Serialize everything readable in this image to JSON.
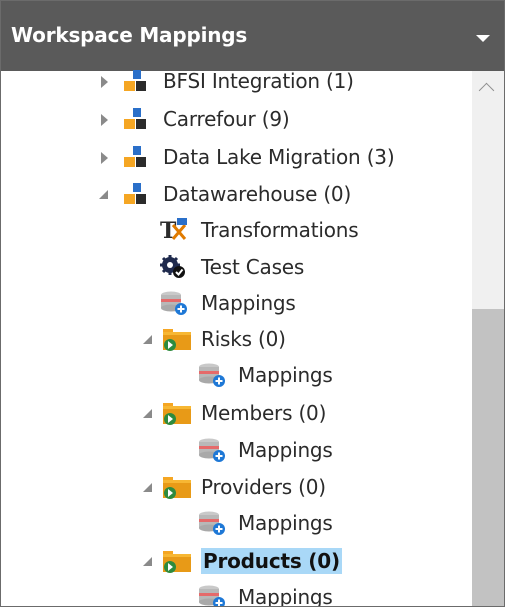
{
  "header": {
    "title": "Workspace Mappings"
  },
  "tree": {
    "items": [
      {
        "label": "BFSI Integration (1)",
        "type": "workspace",
        "expanded": false,
        "level": 0
      },
      {
        "label": "Carrefour (9)",
        "type": "workspace",
        "expanded": false,
        "level": 0
      },
      {
        "label": "Data Lake Migration (3)",
        "type": "workspace",
        "expanded": false,
        "level": 0
      },
      {
        "label": "Datawarehouse (0)",
        "type": "workspace",
        "expanded": true,
        "level": 0
      },
      {
        "label": "Transformations",
        "type": "transformations",
        "level": 1
      },
      {
        "label": "Test Cases",
        "type": "test-cases",
        "level": 1
      },
      {
        "label": "Mappings",
        "type": "mappings",
        "level": 1
      },
      {
        "label": "Risks (0)",
        "type": "subject-area",
        "expanded": true,
        "level": 1
      },
      {
        "label": "Mappings",
        "type": "mappings",
        "level": 2
      },
      {
        "label": "Members (0)",
        "type": "subject-area",
        "expanded": true,
        "level": 1
      },
      {
        "label": "Mappings",
        "type": "mappings",
        "level": 2
      },
      {
        "label": "Providers (0)",
        "type": "subject-area",
        "expanded": true,
        "level": 1
      },
      {
        "label": "Mappings",
        "type": "mappings",
        "level": 2
      },
      {
        "label": "Products (0)",
        "type": "subject-area",
        "expanded": true,
        "selected": true,
        "level": 1
      },
      {
        "label": "Mappings",
        "type": "mappings",
        "level": 2
      }
    ]
  },
  "colors": {
    "header_bg": "#5a5a5a",
    "selection": "#a9d8f7",
    "workspace_orange": "#f5a623",
    "workspace_blue": "#2a6fc9",
    "scroll_thumb": "#c2c2c2"
  }
}
